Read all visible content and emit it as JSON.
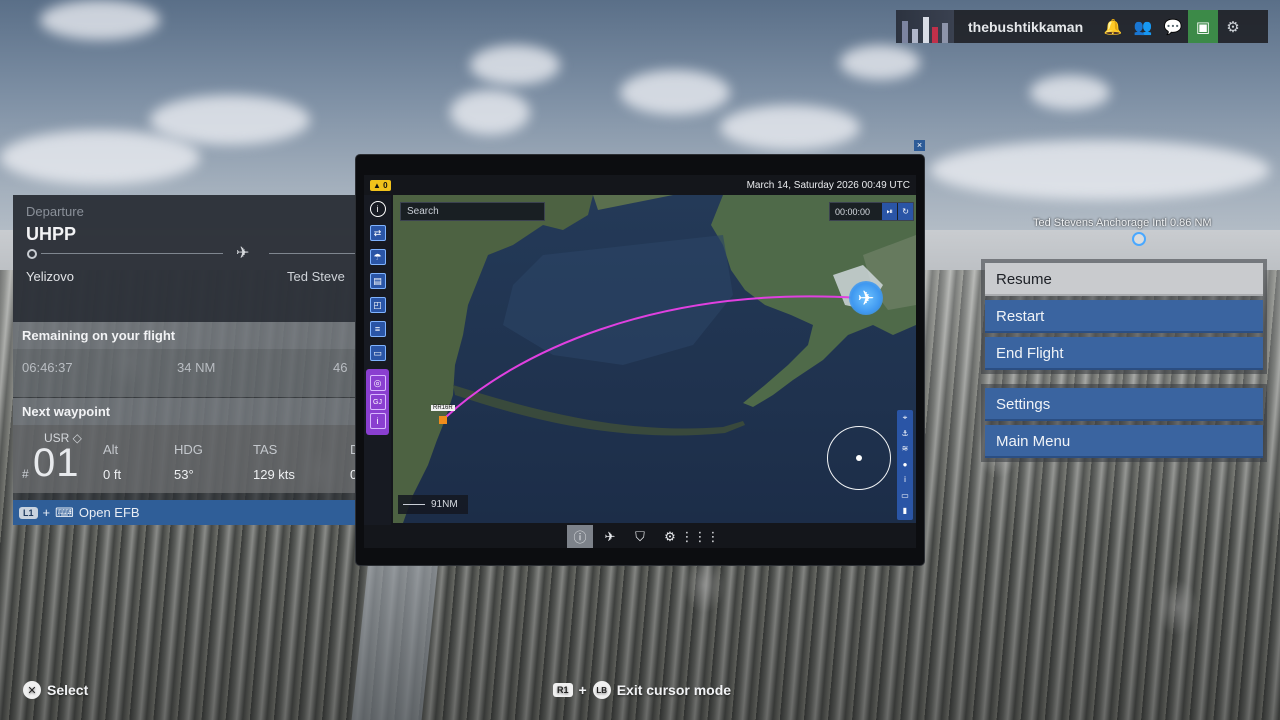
{
  "user": {
    "name": "thebushtikkaman"
  },
  "departure_panel": {
    "departure_label": "Departure",
    "departure_code": "UHPP",
    "departure_city": "Yelizovo",
    "arrival_city": "Ted Steve",
    "remaining_label": "Remaining on your flight",
    "remaining_time": "06:46:37",
    "remaining_distance": "34 NM",
    "remaining_third": "46",
    "next_waypoint_label": "Next waypoint",
    "waypoint_type": "USR",
    "waypoint_hash": "#",
    "waypoint_number": "01",
    "columns": [
      {
        "label": "Alt",
        "value": "0 ft"
      },
      {
        "label": "HDG",
        "value": "53°"
      },
      {
        "label": "TAS",
        "value": "129 kts"
      },
      {
        "label": "D",
        "value": "0"
      }
    ],
    "efb_hint": {
      "button": "L1",
      "plus": "+",
      "label": "Open EFB"
    }
  },
  "pause_menu": {
    "items": [
      "Resume",
      "Restart",
      "End Flight"
    ],
    "items2": [
      "Settings",
      "Main Menu"
    ],
    "focused": "Resume"
  },
  "airport_label": "Ted Stevens Anchorage Intl  0.86 NM",
  "efb": {
    "close": "×",
    "notification_count": "0",
    "datetime": "March 14, Saturday 2026 00:49 UTC",
    "search_placeholder": "Search",
    "timer": "00:00:00",
    "scale": "91NM",
    "origin_tag": "RR16R",
    "purple_label": "GJ"
  },
  "hints": {
    "select": {
      "button": "✕",
      "label": "Select"
    },
    "cursor": {
      "button1": "R1",
      "plus": "+",
      "button2": "LB",
      "label": "Exit cursor mode"
    }
  },
  "colors": {
    "menu_blue": "#3a64a0",
    "route_magenta": "#e040e0",
    "efb_accent": "#2a55a6",
    "purple": "#8a3fd0"
  }
}
